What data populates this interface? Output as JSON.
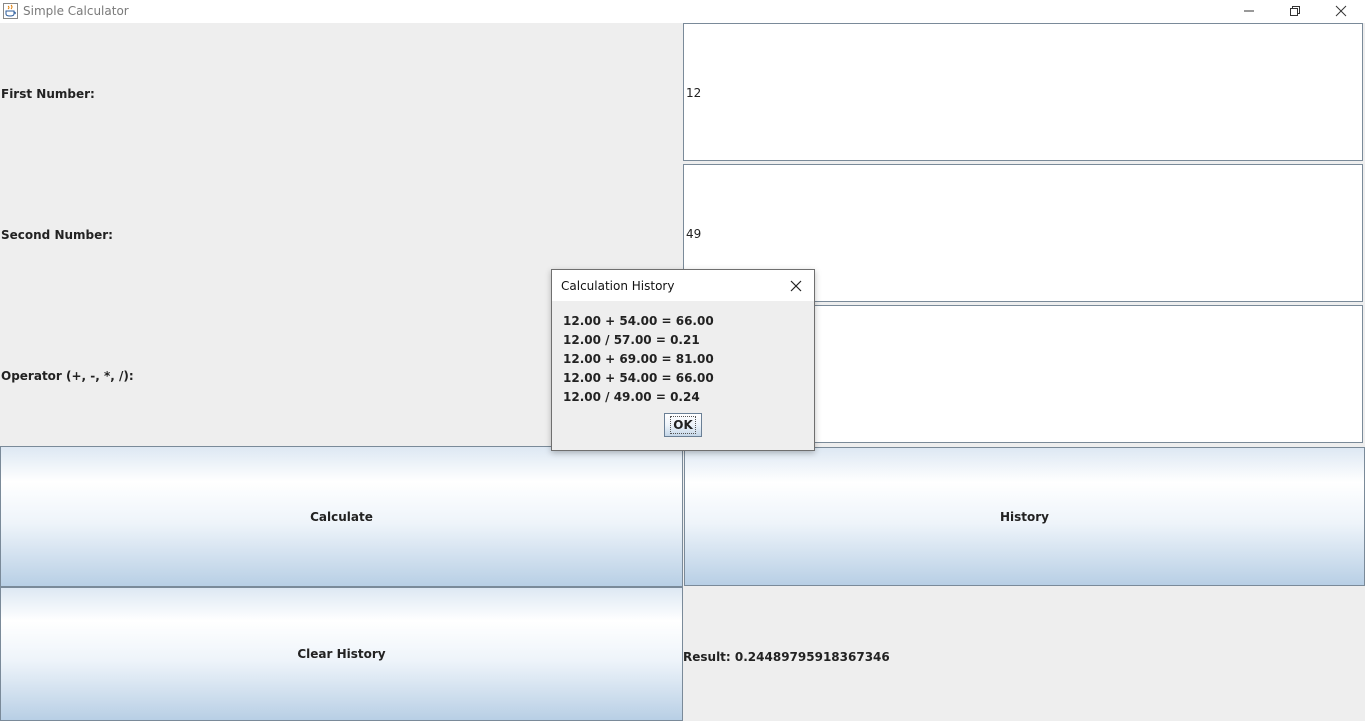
{
  "window": {
    "title": "Simple Calculator"
  },
  "form": {
    "first_label": "First Number:",
    "first_value": "12",
    "second_label": "Second Number:",
    "second_value": "49",
    "operator_label": "Operator (+, -, *, /):",
    "operator_value": ""
  },
  "buttons": {
    "calculate": "Calculate",
    "history": "History",
    "clear_history": "Clear History"
  },
  "result": {
    "text": "Result: 0.24489795918367346"
  },
  "dialog": {
    "title": "Calculation History",
    "entries": [
      "12.00 + 54.00 = 66.00",
      "12.00 / 57.00 = 0.21",
      "12.00 + 69.00 = 81.00",
      "12.00 + 54.00 = 66.00",
      "12.00 / 49.00 = 0.24"
    ],
    "ok_label": "OK"
  },
  "icons": {
    "app": "java-cup-icon",
    "minimize": "minimize-icon",
    "restore": "restore-icon",
    "close": "close-icon",
    "dialog_close": "close-icon"
  }
}
